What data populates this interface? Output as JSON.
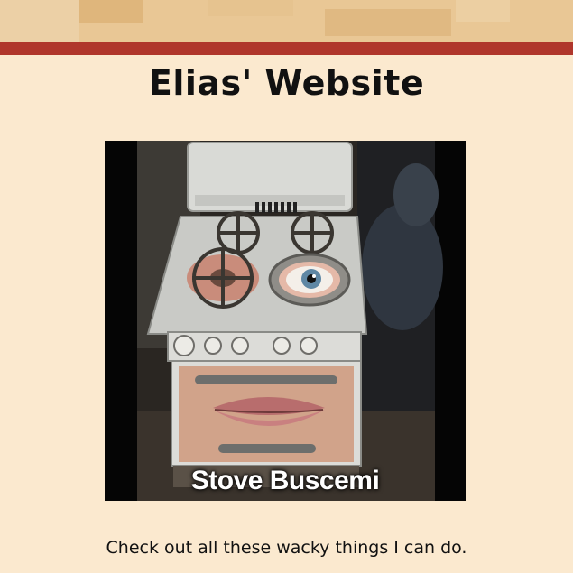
{
  "page": {
    "title": "Elias' Website",
    "caption": "Check out all these wacky things I can do."
  },
  "image": {
    "overlay_text": "Stove Buscemi",
    "subject": "stove-face-meme"
  },
  "colors": {
    "background": "#fbe9cf",
    "top_band": "#e9c795",
    "stripe": "#b0362b",
    "text": "#111111"
  }
}
